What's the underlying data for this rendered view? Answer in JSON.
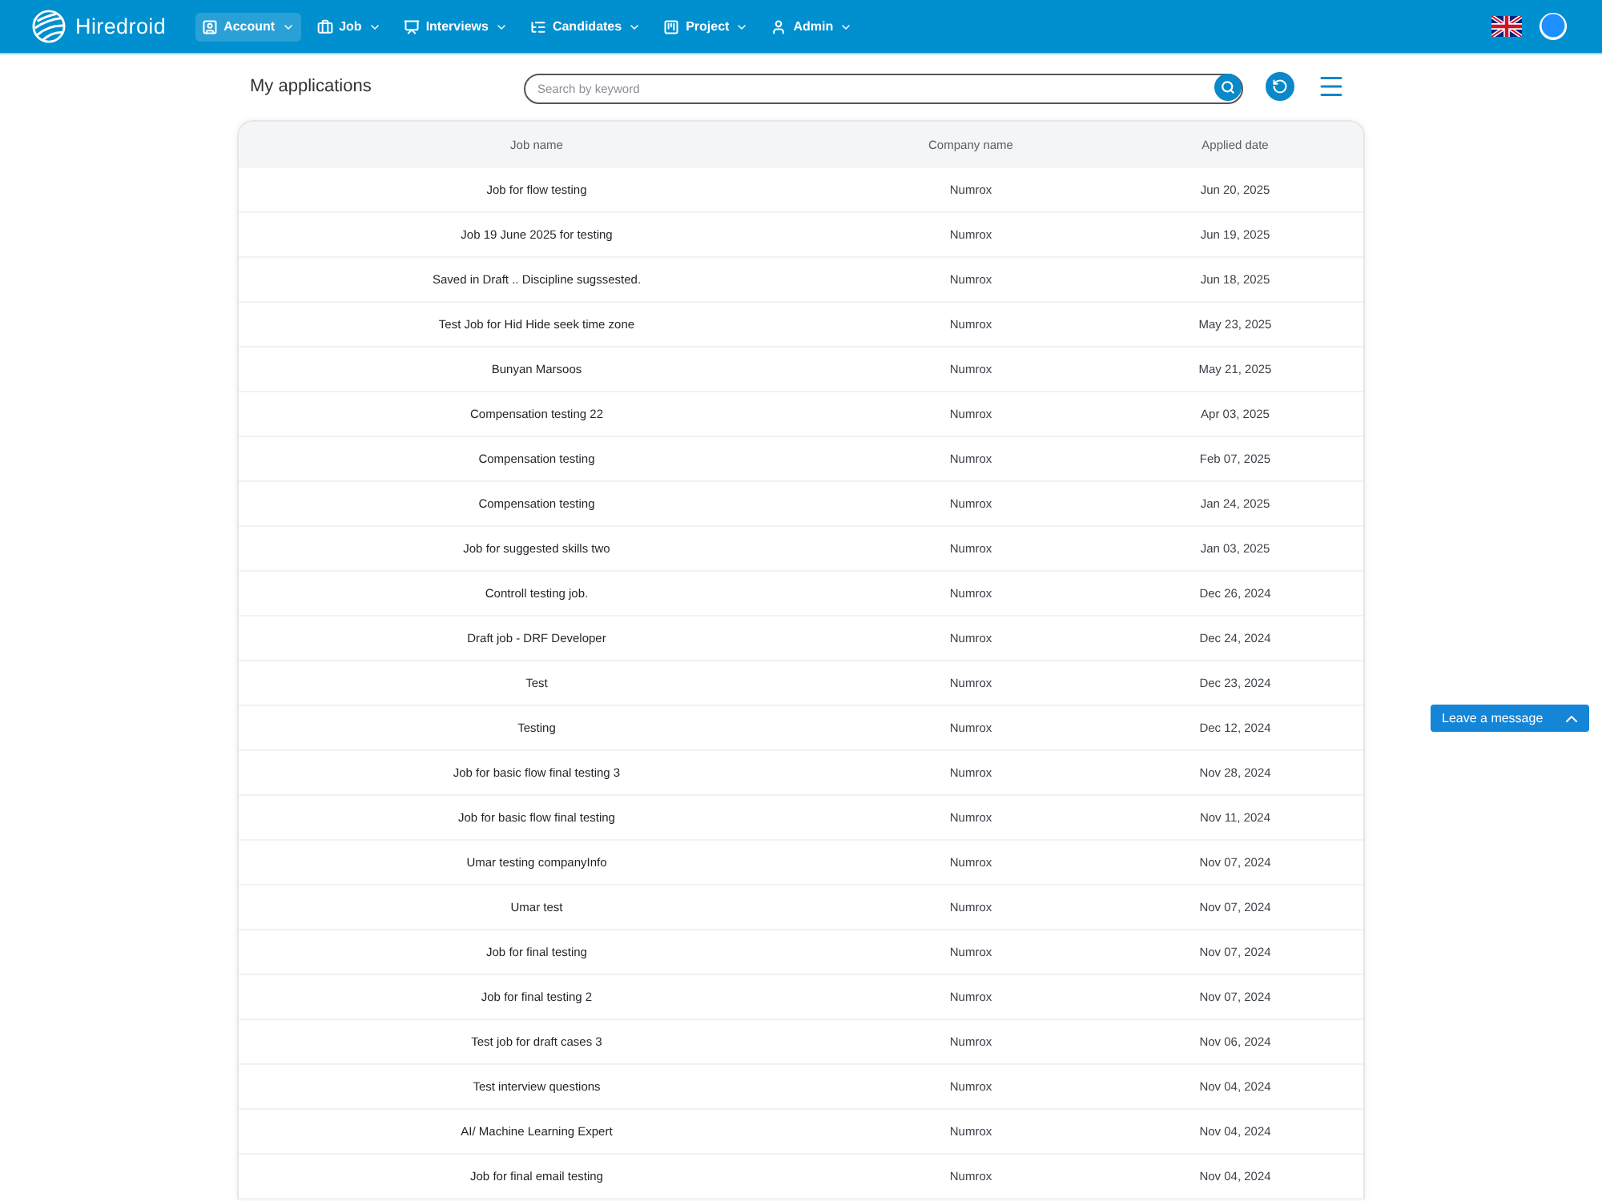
{
  "header": {
    "brand": "Hiredroid",
    "nav": [
      {
        "label": "Account",
        "selected": true
      },
      {
        "label": "Job",
        "selected": false
      },
      {
        "label": "Interviews",
        "selected": false
      },
      {
        "label": "Candidates",
        "selected": false
      },
      {
        "label": "Project",
        "selected": false
      },
      {
        "label": "Admin",
        "selected": false
      }
    ]
  },
  "page": {
    "title": "My applications",
    "search": {
      "placeholder": "Search by keyword"
    }
  },
  "table": {
    "columns": [
      "Job name",
      "Company name",
      "Applied date"
    ],
    "rows": [
      {
        "job_name": "Job for flow testing",
        "company_name": "Numrox",
        "applied_date": "Jun 20, 2025"
      },
      {
        "job_name": "Job 19 June 2025 for testing",
        "company_name": "Numrox",
        "applied_date": "Jun 19, 2025"
      },
      {
        "job_name": "Saved in Draft .. Discipline sugssested.",
        "company_name": "Numrox",
        "applied_date": "Jun 18, 2025"
      },
      {
        "job_name": "Test Job for Hid Hide seek time zone",
        "company_name": "Numrox",
        "applied_date": "May 23, 2025"
      },
      {
        "job_name": "Bunyan Marsoos",
        "company_name": "Numrox",
        "applied_date": "May 21, 2025"
      },
      {
        "job_name": "Compensation testing 22",
        "company_name": "Numrox",
        "applied_date": "Apr 03, 2025"
      },
      {
        "job_name": "Compensation testing",
        "company_name": "Numrox",
        "applied_date": "Feb 07, 2025"
      },
      {
        "job_name": "Compensation testing",
        "company_name": "Numrox",
        "applied_date": "Jan 24, 2025"
      },
      {
        "job_name": "Job for suggested skills two",
        "company_name": "Numrox",
        "applied_date": "Jan 03, 2025"
      },
      {
        "job_name": "Controll testing job.",
        "company_name": "Numrox",
        "applied_date": "Dec 26, 2024"
      },
      {
        "job_name": "Draft job - DRF Developer",
        "company_name": "Numrox",
        "applied_date": "Dec 24, 2024"
      },
      {
        "job_name": "Test",
        "company_name": "Numrox",
        "applied_date": "Dec 23, 2024"
      },
      {
        "job_name": "Testing",
        "company_name": "Numrox",
        "applied_date": "Dec 12, 2024"
      },
      {
        "job_name": "Job for basic flow final testing 3",
        "company_name": "Numrox",
        "applied_date": "Nov 28, 2024"
      },
      {
        "job_name": "Job for basic flow final testing",
        "company_name": "Numrox",
        "applied_date": "Nov 11, 2024"
      },
      {
        "job_name": "Umar testing companyInfo",
        "company_name": "Numrox",
        "applied_date": "Nov 07, 2024"
      },
      {
        "job_name": "Umar test",
        "company_name": "Numrox",
        "applied_date": "Nov 07, 2024"
      },
      {
        "job_name": "Job for final testing",
        "company_name": "Numrox",
        "applied_date": "Nov 07, 2024"
      },
      {
        "job_name": "Job for final testing 2",
        "company_name": "Numrox",
        "applied_date": "Nov 07, 2024"
      },
      {
        "job_name": "Test job for draft cases 3",
        "company_name": "Numrox",
        "applied_date": "Nov 06, 2024"
      },
      {
        "job_name": "Test interview questions",
        "company_name": "Numrox",
        "applied_date": "Nov 04, 2024"
      },
      {
        "job_name": "AI/ Machine Learning Expert",
        "company_name": "Numrox",
        "applied_date": "Nov 04, 2024"
      },
      {
        "job_name": "Job for final email testing",
        "company_name": "Numrox",
        "applied_date": "Nov 04, 2024"
      }
    ]
  },
  "chat_widget": {
    "label": "Leave a message"
  }
}
